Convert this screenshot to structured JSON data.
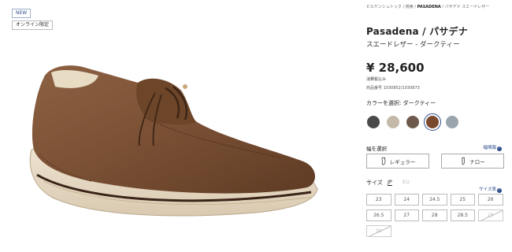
{
  "badges": {
    "new": "NEW",
    "online": "オンライン限定"
  },
  "breadcrumb": {
    "home": "ビルケンシュトック",
    "sep1": " / ",
    "search": "検索",
    "sep2": " / ",
    "current": "PASADENA",
    "current_rest": " / パサデナ スエードレザー"
  },
  "product": {
    "title": "Pasadena / パサデナ",
    "subtitle": "スエードレザー - ダークティー",
    "price": "¥ 28,600",
    "tax": "消費税込み",
    "sku": "商品番号 1030852/1030873",
    "color_label": "カラーを選択: ダークティー"
  },
  "swatches": [
    {
      "name": "charcoal",
      "color": "#4a4a4a",
      "selected": false
    },
    {
      "name": "taupe",
      "color": "#c4b8a8",
      "selected": false
    },
    {
      "name": "mocha",
      "color": "#6e5a4c",
      "selected": false
    },
    {
      "name": "dark-tea",
      "color": "#7a4a2e",
      "selected": true
    },
    {
      "name": "grey",
      "color": "#9aa5ad",
      "selected": false
    }
  ],
  "width": {
    "label": "幅を選択",
    "guide": "幅情報",
    "options": [
      "レギュラー",
      "ナロー"
    ]
  },
  "size": {
    "label": "サイズ",
    "tab_jp": "JP",
    "tab_eu": "EU",
    "chart": "サイズ表",
    "options": [
      {
        "label": "23",
        "available": true
      },
      {
        "label": "24",
        "available": true
      },
      {
        "label": "24.5",
        "available": true
      },
      {
        "label": "25",
        "available": true
      },
      {
        "label": "26",
        "available": true
      },
      {
        "label": "26.5",
        "available": true
      },
      {
        "label": "27",
        "available": true
      },
      {
        "label": "28",
        "available": true
      },
      {
        "label": "28.5",
        "available": true
      },
      {
        "label": "29",
        "available": false
      },
      {
        "label": "30",
        "available": false
      }
    ]
  }
}
